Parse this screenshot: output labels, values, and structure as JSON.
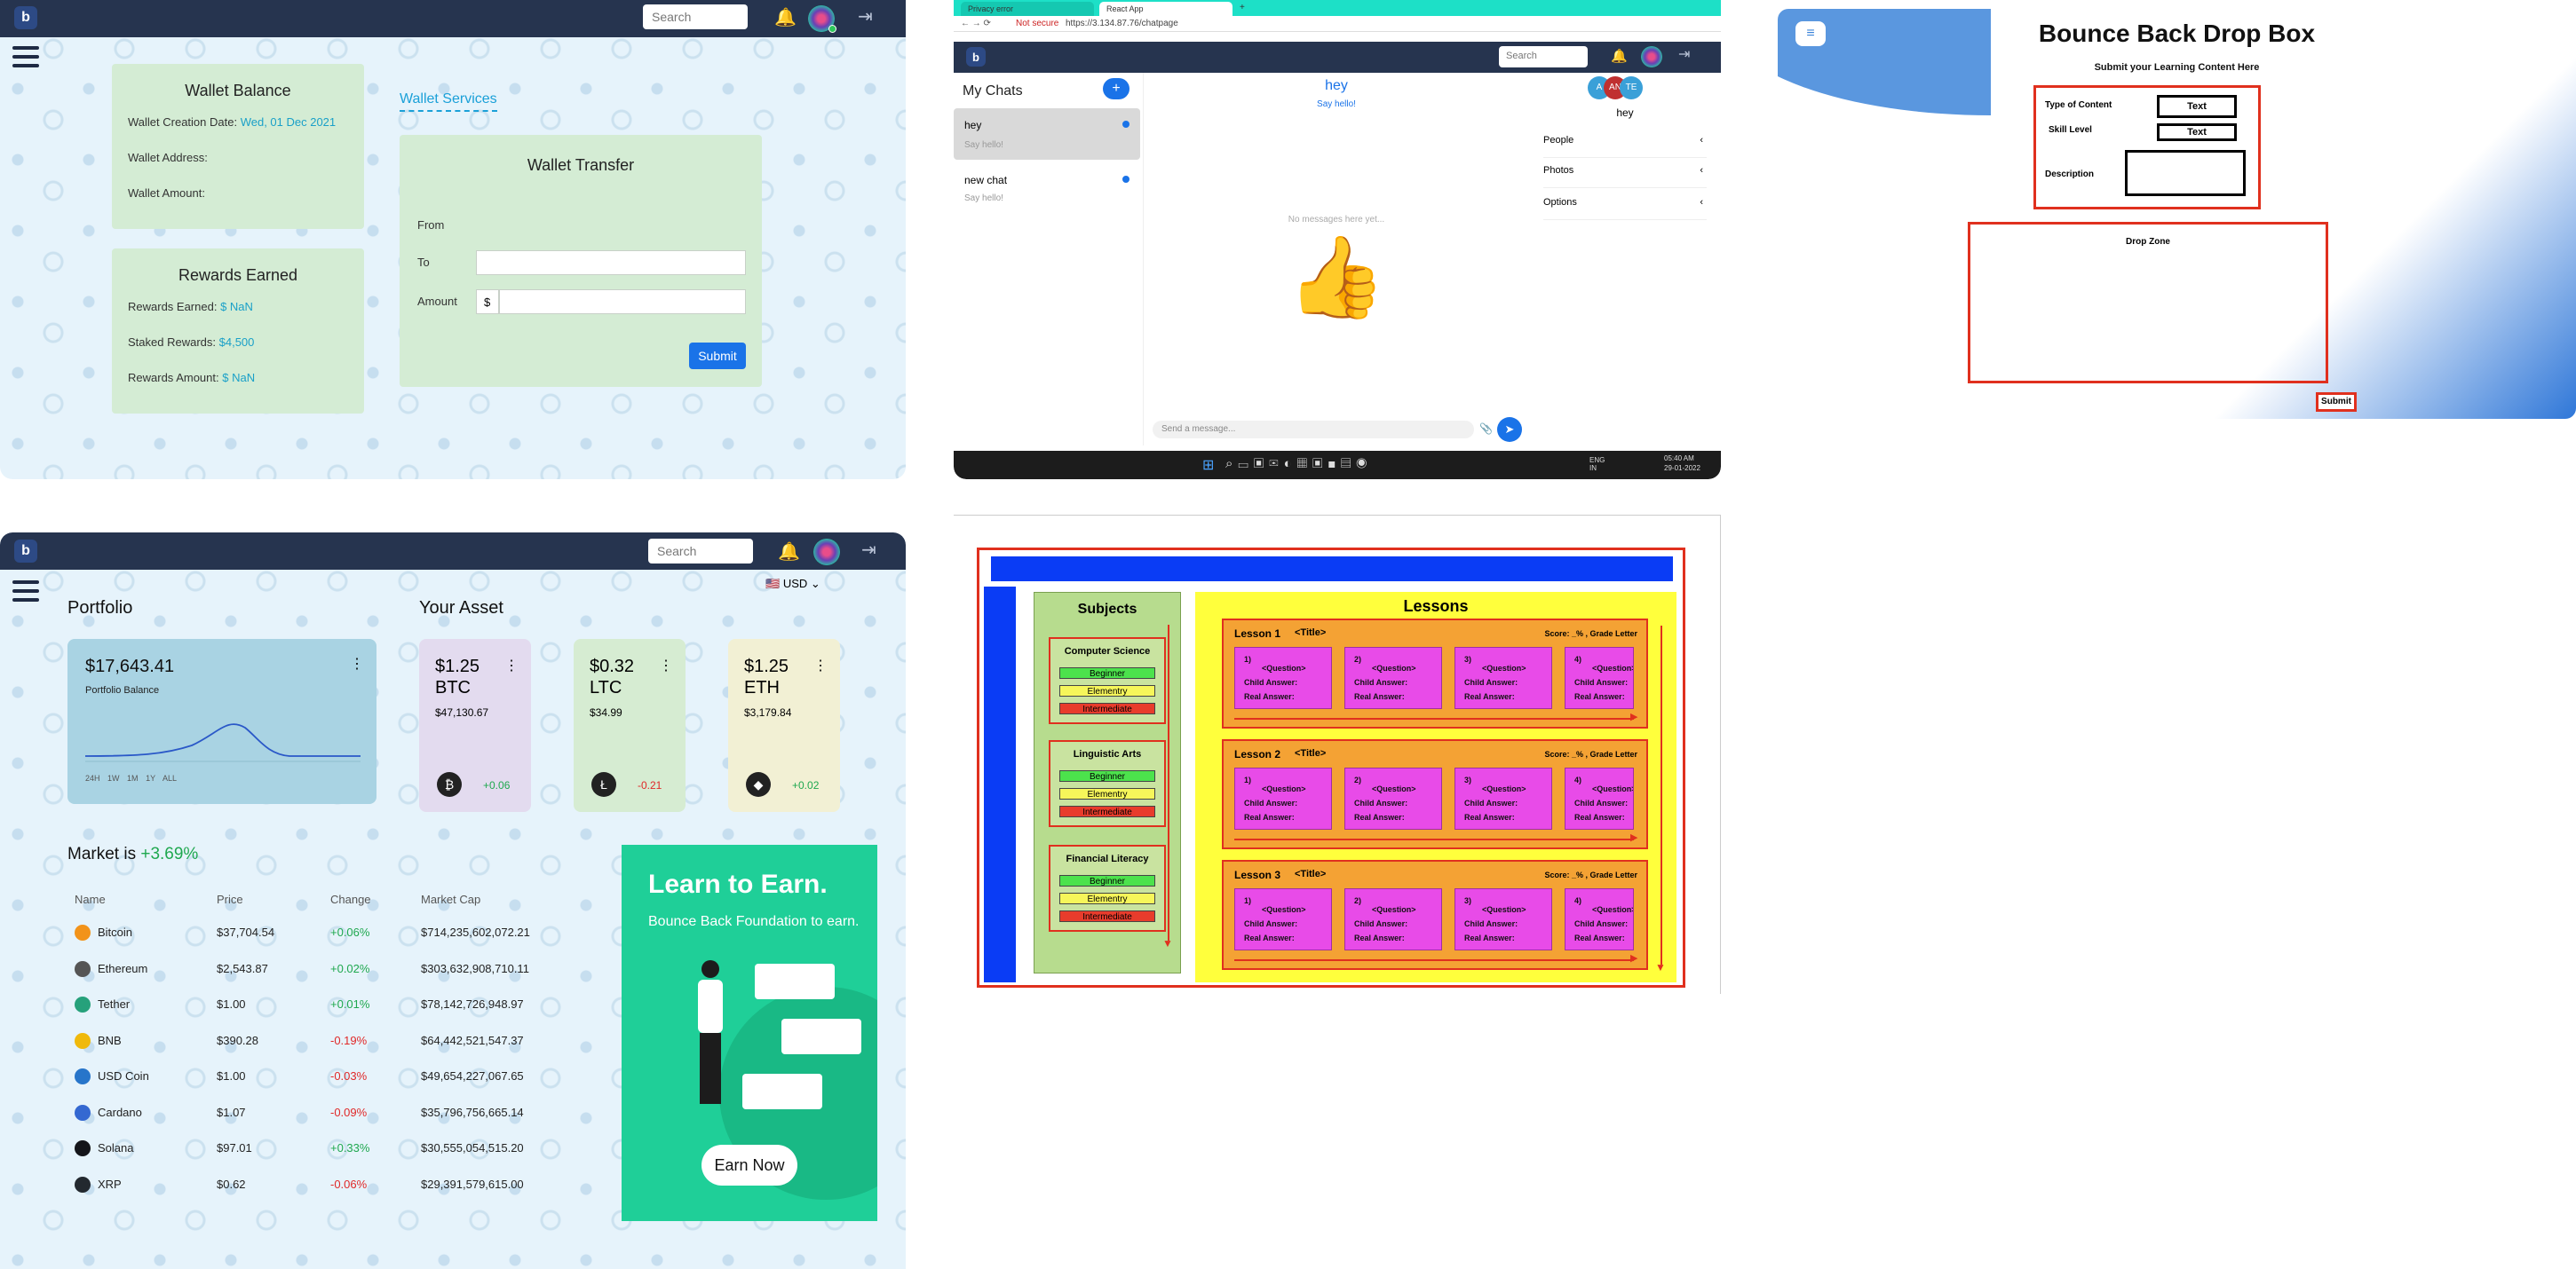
{
  "wallet": {
    "search_placeholder": "Search",
    "wallet_balance_title": "Wallet Balance",
    "creation_label": "Wallet Creation Date:",
    "creation_value": "Wed, 01 Dec 2021",
    "address_label": "Wallet Address:",
    "amount_label": "Wallet Amount:",
    "services_link": "Wallet Services",
    "rewards_title": "Rewards Earned",
    "rewards_earned_label": "Rewards Earned:",
    "rewards_earned_value": "$ NaN",
    "staked_label": "Staked Rewards:",
    "staked_value": "$4,500",
    "rewards_amount_label": "Rewards Amount:",
    "rewards_amount_value": "$ NaN",
    "transfer_title": "Wallet Transfer",
    "from_label": "From",
    "to_label": "To",
    "amount_label2": "Amount",
    "currency_symbol": "$",
    "submit_label": "Submit"
  },
  "chat": {
    "tab1": "Privacy error",
    "tab2": "React App",
    "not_secure": "Not secure",
    "url": "https://3.134.87.76/chatpage",
    "search_placeholder": "Search",
    "my_chats": "My Chats",
    "plus": "+",
    "chats": [
      {
        "name": "hey",
        "preview": "Say hello!"
      },
      {
        "name": "new chat",
        "preview": "Say hello!"
      }
    ],
    "header_title": "hey",
    "header_sub": "Say hello!",
    "empty_msg": "No messages here yet...",
    "thumb": "👍",
    "send_placeholder": "Send a message...",
    "members": [
      "A",
      "AN",
      "TE"
    ],
    "room_name": "hey",
    "sections": [
      "People",
      "Photos",
      "Options"
    ],
    "taskbar_lang": "ENG\nIN",
    "clock_time": "05:40 AM",
    "clock_date": "29-01-2022"
  },
  "dropbox": {
    "title": "Bounce Back Drop Box",
    "subtitle": "Submit your Learning Content Here",
    "type_label": "Type of Content",
    "type_value": "Text",
    "skill_label": "Skill Level",
    "skill_value": "Text",
    "desc_label": "Description",
    "drop_zone": "Drop Zone",
    "submit": "Submit"
  },
  "portfolio": {
    "search_placeholder": "Search",
    "currency": "USD",
    "portfolio_title": "Portfolio",
    "balance": "$17,643.41",
    "balance_label": "Portfolio Balance",
    "ranges": [
      "24H",
      "1W",
      "1M",
      "1Y",
      "ALL"
    ],
    "asset_title": "Your Asset",
    "assets": [
      {
        "price": "$1.25",
        "sym": "BTC",
        "sub": "$47,130.67",
        "change": "+0.06",
        "color": "#e3dbef"
      },
      {
        "price": "$0.32",
        "sym": "LTC",
        "sub": "$34.99",
        "change": "-0.21",
        "color": "#d6ecd2"
      },
      {
        "price": "$1.25",
        "sym": "ETH",
        "sub": "$3,179.84",
        "change": "+0.02",
        "color": "#f2f0d4"
      }
    ],
    "market_prefix": "Market is",
    "market_change": "+3.69%",
    "columns": [
      "Name",
      "Price",
      "Change",
      "Market Cap"
    ],
    "rows": [
      {
        "name": "Bitcoin",
        "price": "$37,704.54",
        "change": "+0.06%",
        "cap": "$714,235,602,072.21",
        "color": "#f2931a"
      },
      {
        "name": "Ethereum",
        "price": "$2,543.87",
        "change": "+0.02%",
        "cap": "$303,632,908,710.11",
        "color": "#555555"
      },
      {
        "name": "Tether",
        "price": "$1.00",
        "change": "+0.01%",
        "cap": "$78,142,726,948.97",
        "color": "#26a17b"
      },
      {
        "name": "BNB",
        "price": "$390.28",
        "change": "-0.19%",
        "cap": "$64,442,521,547.37",
        "color": "#f0b90b"
      },
      {
        "name": "USD Coin",
        "price": "$1.00",
        "change": "-0.03%",
        "cap": "$49,654,227,067.65",
        "color": "#2775ca"
      },
      {
        "name": "Cardano",
        "price": "$1.07",
        "change": "-0.09%",
        "cap": "$35,796,756,665.14",
        "color": "#3468d1"
      },
      {
        "name": "Solana",
        "price": "$97.01",
        "change": "+0.33%",
        "cap": "$30,555,054,515.20",
        "color": "#14151a"
      },
      {
        "name": "XRP",
        "price": "$0.62",
        "change": "-0.06%",
        "cap": "$29,391,579,615.00",
        "color": "#23292f"
      }
    ],
    "promo_title": "Learn to Earn.",
    "promo_sub": "Bounce Back Foundation to earn.",
    "promo_button": "Earn Now"
  },
  "lessons": {
    "subjects_title": "Subjects",
    "lessons_title": "Lessons",
    "subjects": [
      "Computer Science",
      "Linguistic Arts",
      "Financial Literacy"
    ],
    "levels": [
      "Beginner",
      "Elementry",
      "Intermediate"
    ],
    "lesson_rows": [
      {
        "name": "Lesson 1",
        "title": "<Title>",
        "score": "Score: _% , Grade Letter"
      },
      {
        "name": "Lesson 2",
        "title": "<Title>",
        "score": "Score: _% , Grade Letter"
      },
      {
        "name": "Lesson 3",
        "title": "<Title>",
        "score": "Score: _% , Grade Letter"
      }
    ],
    "question_numbers": [
      "1)",
      "2)",
      "3)",
      "4)"
    ],
    "question_label": "<Question>",
    "child_answer": "Child Answer:",
    "real_answer": "Real Answer:"
  }
}
